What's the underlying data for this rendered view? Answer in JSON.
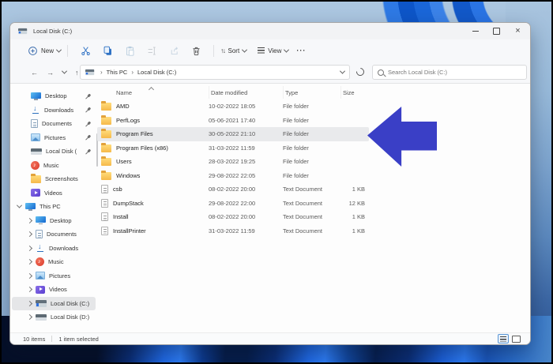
{
  "window": {
    "title": "Local Disk (C:)",
    "close_glyph": "×"
  },
  "toolbar": {
    "new_label": "New",
    "sort_label": "Sort",
    "view_label": "View",
    "more_glyph": "···",
    "sort_glyph": "↑↓"
  },
  "address": {
    "back_glyph": "←",
    "forward_glyph": "→",
    "up_glyph": "↑",
    "separator": "›",
    "breadcrumb": [
      "This PC",
      "Local Disk (C:)"
    ],
    "search_placeholder": "Search Local Disk (C:)"
  },
  "sidebar": {
    "quick": [
      {
        "label": "Desktop",
        "icon": "monitor",
        "pinned": true
      },
      {
        "label": "Downloads",
        "icon": "download",
        "pinned": true
      },
      {
        "label": "Documents",
        "icon": "document",
        "pinned": true
      },
      {
        "label": "Pictures",
        "icon": "picture",
        "pinned": true
      },
      {
        "label": "Local Disk (",
        "icon": "drive-plain",
        "pinned": true
      },
      {
        "label": "Music",
        "icon": "music",
        "pinned": false
      },
      {
        "label": "Screenshots",
        "icon": "folder",
        "pinned": false
      },
      {
        "label": "Videos",
        "icon": "videos",
        "pinned": false
      }
    ],
    "this_pc_label": "This PC",
    "children": [
      {
        "label": "Desktop",
        "icon": "monitor"
      },
      {
        "label": "Documents",
        "icon": "document"
      },
      {
        "label": "Downloads",
        "icon": "download"
      },
      {
        "label": "Music",
        "icon": "music"
      },
      {
        "label": "Pictures",
        "icon": "picture"
      },
      {
        "label": "Videos",
        "icon": "videos"
      },
      {
        "label": "Local Disk (C:)",
        "icon": "drive",
        "selected": true
      },
      {
        "label": "Local Disk (D:)",
        "icon": "drive-plain"
      }
    ]
  },
  "files": {
    "columns": [
      "Name",
      "Date modified",
      "Type",
      "Size"
    ],
    "rows": [
      {
        "name": "AMD",
        "date": "10-02-2022 18:05",
        "type": "File folder",
        "size": "",
        "icon": "folder"
      },
      {
        "name": "PerfLogs",
        "date": "05-06-2021 17:40",
        "type": "File folder",
        "size": "",
        "icon": "folder"
      },
      {
        "name": "Program Files",
        "date": "30-05-2022 21:10",
        "type": "File folder",
        "size": "",
        "icon": "folder",
        "selected": true
      },
      {
        "name": "Program Files (x86)",
        "date": "31-03-2022 11:59",
        "type": "File folder",
        "size": "",
        "icon": "folder"
      },
      {
        "name": "Users",
        "date": "28-03-2022 19:25",
        "type": "File folder",
        "size": "",
        "icon": "folder"
      },
      {
        "name": "Windows",
        "date": "29-08-2022 22:05",
        "type": "File folder",
        "size": "",
        "icon": "folder"
      },
      {
        "name": "csb",
        "date": "08-02-2022 20:00",
        "type": "Text Document",
        "size": "1 KB",
        "icon": "doc"
      },
      {
        "name": "DumpStack",
        "date": "29-08-2022 22:00",
        "type": "Text Document",
        "size": "12 KB",
        "icon": "doc"
      },
      {
        "name": "Install",
        "date": "08-02-2022 20:00",
        "type": "Text Document",
        "size": "1 KB",
        "icon": "doc"
      },
      {
        "name": "InstallPrinter",
        "date": "31-03-2022 11:59",
        "type": "Text Document",
        "size": "1 KB",
        "icon": "doc"
      }
    ]
  },
  "status": {
    "items_label": "10 items",
    "selected_label": "1 item selected"
  },
  "colors": {
    "arrow": "#3a3fc6",
    "accent": "#2e71c4",
    "selection": "#e9eaec"
  }
}
